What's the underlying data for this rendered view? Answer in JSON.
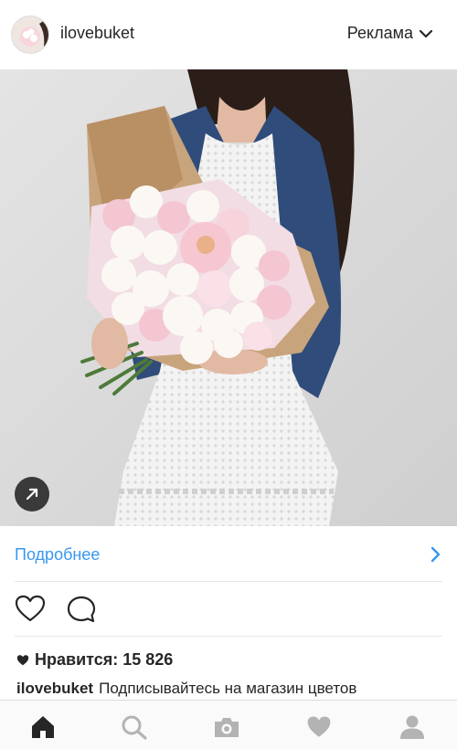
{
  "post": {
    "username": "ilovebuket",
    "sponsored_label": "Реклама",
    "more_link_label": "Подробнее",
    "likes_text": "Нравится: 15 826",
    "caption_user": "ilovebuket",
    "caption_text": "Подписывайтесь на магазин цветов"
  },
  "icons": {
    "sponsored_menu": "chevron-down-icon",
    "expand": "arrow-up-right-icon",
    "more": "chevron-right-icon",
    "like": "heart-icon",
    "comment": "comment-icon",
    "likes": "heart-filled-icon"
  },
  "tabs": [
    "home-icon",
    "search-icon",
    "camera-icon",
    "heart-icon",
    "profile-icon"
  ],
  "colors": {
    "link": "#3897f0",
    "text": "#262626",
    "tab_active": "#262626",
    "tab_inactive": "#b3b3b3"
  }
}
